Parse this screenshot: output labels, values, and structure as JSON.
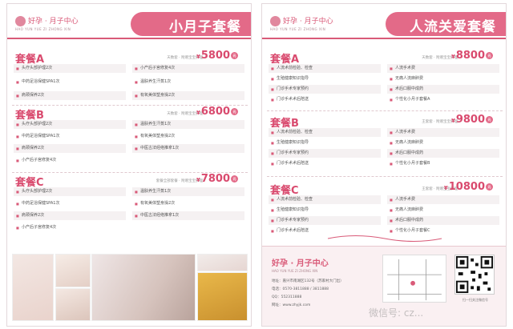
{
  "brand": {
    "name": "好孕 · 月子中心",
    "sub": "HAO YUN YUE ZI ZHONG XIN"
  },
  "left": {
    "title": "小月子套餐",
    "packages": [
      {
        "name": "套餐A",
        "note": "天数套 · 附赠宝宝护理",
        "currency": "¥",
        "price": "5800",
        "unit": "元",
        "items_left": [
          "头疗头部护理2次",
          "中药足浴保健SPA1次",
          "肩颈保养2次"
        ],
        "items_right": [
          "小产后子宫修复4次",
          "温肤养生汗蒸1次",
          "有氧美体塑身操2次"
        ]
      },
      {
        "name": "套餐B",
        "note": "天数套 · 附赠宝宝护理",
        "currency": "¥",
        "price": "6800",
        "unit": "元",
        "items_left": [
          "头疗头部护理2次",
          "中药足浴保健SPA1次",
          "肩颈保养2次",
          "小产后子宫修复4次"
        ],
        "items_right": [
          "温肤养生汗蒸1次",
          "有氧美体塑身操2次",
          "中医古法经络推拿1次"
        ]
      },
      {
        "name": "套餐C",
        "note": "套餐全部套餐 · 附赠宝宝护理",
        "currency": "¥",
        "price": "7800",
        "unit": "元",
        "items_left": [
          "头疗头部护理2次",
          "中药足浴保健SPA1次",
          "肩颈保养2次",
          "小产后子宫修复4次"
        ],
        "items_right": [
          "温肤养生汗蒸1次",
          "有氧美体塑身操2次",
          "中医古法经络推拿1次"
        ]
      }
    ]
  },
  "right": {
    "title": "人流关爱套餐",
    "packages": [
      {
        "name": "套餐A",
        "note": "天数套 · 附赠宝宝护理",
        "currency": "¥",
        "price": "8800",
        "unit": "元",
        "items_left": [
          "人流术前检验、检查",
          "生殖健康知识指导",
          "门诊手术专家预约",
          "门诊手术术后陪送"
        ],
        "items_right": [
          "人流手术费",
          "无痛人流麻醉费",
          "术后口服中成药",
          "个性化小月子套餐A"
        ]
      },
      {
        "name": "套餐B",
        "note": "王套套 · 附赠宝宝护理",
        "currency": "¥",
        "price": "9800",
        "unit": "元",
        "items_left": [
          "人流术前检验、检查",
          "生殖健康知识指导",
          "门诊手术专家预约",
          "门诊手术术后陪送"
        ],
        "items_right": [
          "人流手术费",
          "无痛人流麻醉费",
          "术后口服中成药",
          "个性化小月子套餐B"
        ]
      },
      {
        "name": "套餐C",
        "note": "王套套 · 附赠宝宝护理",
        "currency": "¥",
        "price": "10800",
        "unit": "元",
        "items_left": [
          "人流术前检验、检查",
          "生殖健康知识指导",
          "门诊手术专家预约",
          "门诊手术术后陪送"
        ],
        "items_right": [
          "人流手术费",
          "无痛人流麻醉费",
          "术后口服中成药",
          "个性化小月子套餐C"
        ]
      }
    ],
    "footer": {
      "address": "地址：嘉兴市南湖区132号（苏家村大门出）",
      "phone": "电话：0570-3811888 / 3811888",
      "qq": "QQ：552311888",
      "web": "网址：www.zhyjk.com",
      "qr_caption": "扫一扫关注微信号"
    }
  },
  "watermark": "微信号: cz..."
}
